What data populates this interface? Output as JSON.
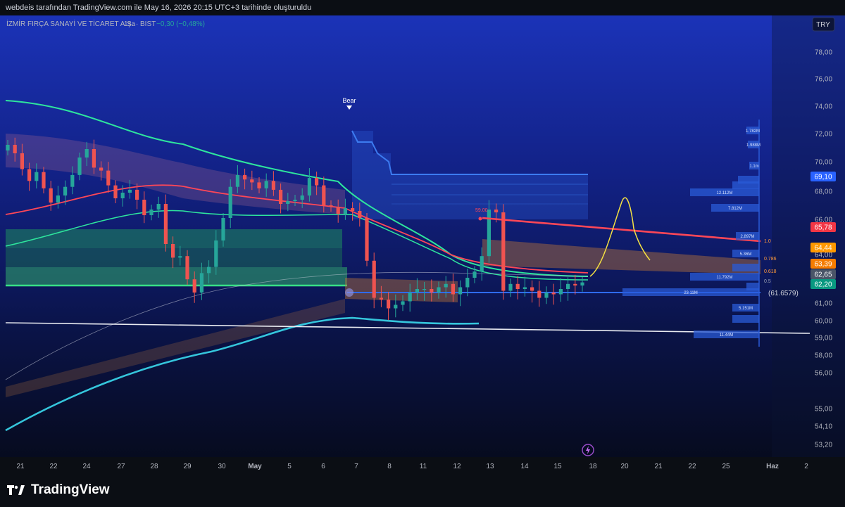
{
  "header": {
    "watermark": "webdeis tarafından TradingView.com ile May 16, 2026 20:15 UTC+3 tarihinde oluşturuldu"
  },
  "symbol": {
    "name": "İZMİR FIRÇA SANAYİ VE TİCARET A.Ş.",
    "interval": "1sa",
    "exchange": "BIST",
    "change": "−0,30 (−0,48%)",
    "currency": "TRY"
  },
  "footer": {
    "brand": "TradingView"
  },
  "colors": {
    "background_top": "#1a2fa8",
    "background_bottom": "#070b1d",
    "up_candle": "#26a69a",
    "down_candle": "#ef5350",
    "upper_band": "#2ee59d",
    "lower_band": "#35c6dc",
    "red_line": "#ff4757",
    "support_line": "#ffffff",
    "green_zone": "#1f8e5f",
    "volume_profile": "#2a5bd7",
    "projection": "#f5e142"
  },
  "chart_data": {
    "type": "candlestick",
    "y_axis": {
      "range": [
        52.2,
        80.4
      ],
      "ticks": [
        "78,00",
        "76,00",
        "74,00",
        "72,00",
        "70,00",
        "68,00",
        "66,00",
        "64,00",
        "62,00",
        "61,00",
        "60,00",
        "59,00",
        "58,00",
        "56,00",
        "55,00",
        "54,10",
        "53,20"
      ],
      "labels": [
        {
          "value": "69,10",
          "price": 69.1,
          "color": "#2962ff"
        },
        {
          "value": "65,78",
          "price": 65.78,
          "color": "#f23645"
        },
        {
          "value": "64,44",
          "price": 64.44,
          "color": "#ff9800"
        },
        {
          "value": "63,39",
          "price": 63.39,
          "color": "#f57c00"
        },
        {
          "value": "62,65",
          "price": 62.65,
          "color": "#4a5568"
        },
        {
          "value": "62,20",
          "price": 62.2,
          "color": "#089981"
        }
      ]
    },
    "x_axis": {
      "ticks": [
        "21",
        "22",
        "24",
        "27",
        "28",
        "29",
        "30",
        "May",
        "5",
        "6",
        "7",
        "8",
        "11",
        "12",
        "13",
        "14",
        "15",
        "18",
        "20",
        "21",
        "22",
        "25",
        "Haz",
        "2"
      ]
    },
    "annotations": {
      "bear_label": "Bear",
      "high_label": "59.00",
      "poc_label": "(61.6579)",
      "fib_levels": [
        "1.0",
        "0.786",
        "0.618",
        "0.5"
      ]
    },
    "volume_profile_labels": [
      "1.782M",
      "1.988M",
      "1.1m",
      "12.112M",
      "7.812M",
      "2.897M",
      "5.36M",
      "11.792M",
      "23.11M",
      "5.151M",
      "11.44M"
    ],
    "close_series": [
      71.2,
      70.6,
      69.5,
      68.7,
      69.3,
      68.2,
      67.2,
      67.7,
      68.3,
      69.1,
      70.3,
      70.9,
      69.6,
      69.4,
      68.4,
      67.5,
      67.9,
      68.1,
      67.4,
      66.3,
      66.7,
      67.1,
      64.6,
      63.8,
      63.9,
      62.4,
      61.6,
      62.8,
      63.2,
      64.8,
      66.1,
      68.3,
      69.1,
      68.8,
      68.6,
      68.2,
      68.7,
      68.1,
      67.1,
      67.3,
      67.4,
      67.7,
      68.9,
      68.4,
      67.0,
      66.9,
      66.4,
      66.8,
      66.6,
      66.1,
      63.6,
      61.3,
      61.2,
      60.7,
      60.9,
      61.1,
      61.6,
      61.8,
      61.8,
      61.6,
      61.9,
      62.1,
      61.5,
      61.9,
      62.5,
      62.9,
      63.9,
      66.7,
      66.5,
      61.7,
      62.1,
      61.8,
      61.9,
      61.7,
      61.3,
      61.6,
      61.5,
      61.8,
      62.1,
      62.0,
      62.2
    ]
  }
}
